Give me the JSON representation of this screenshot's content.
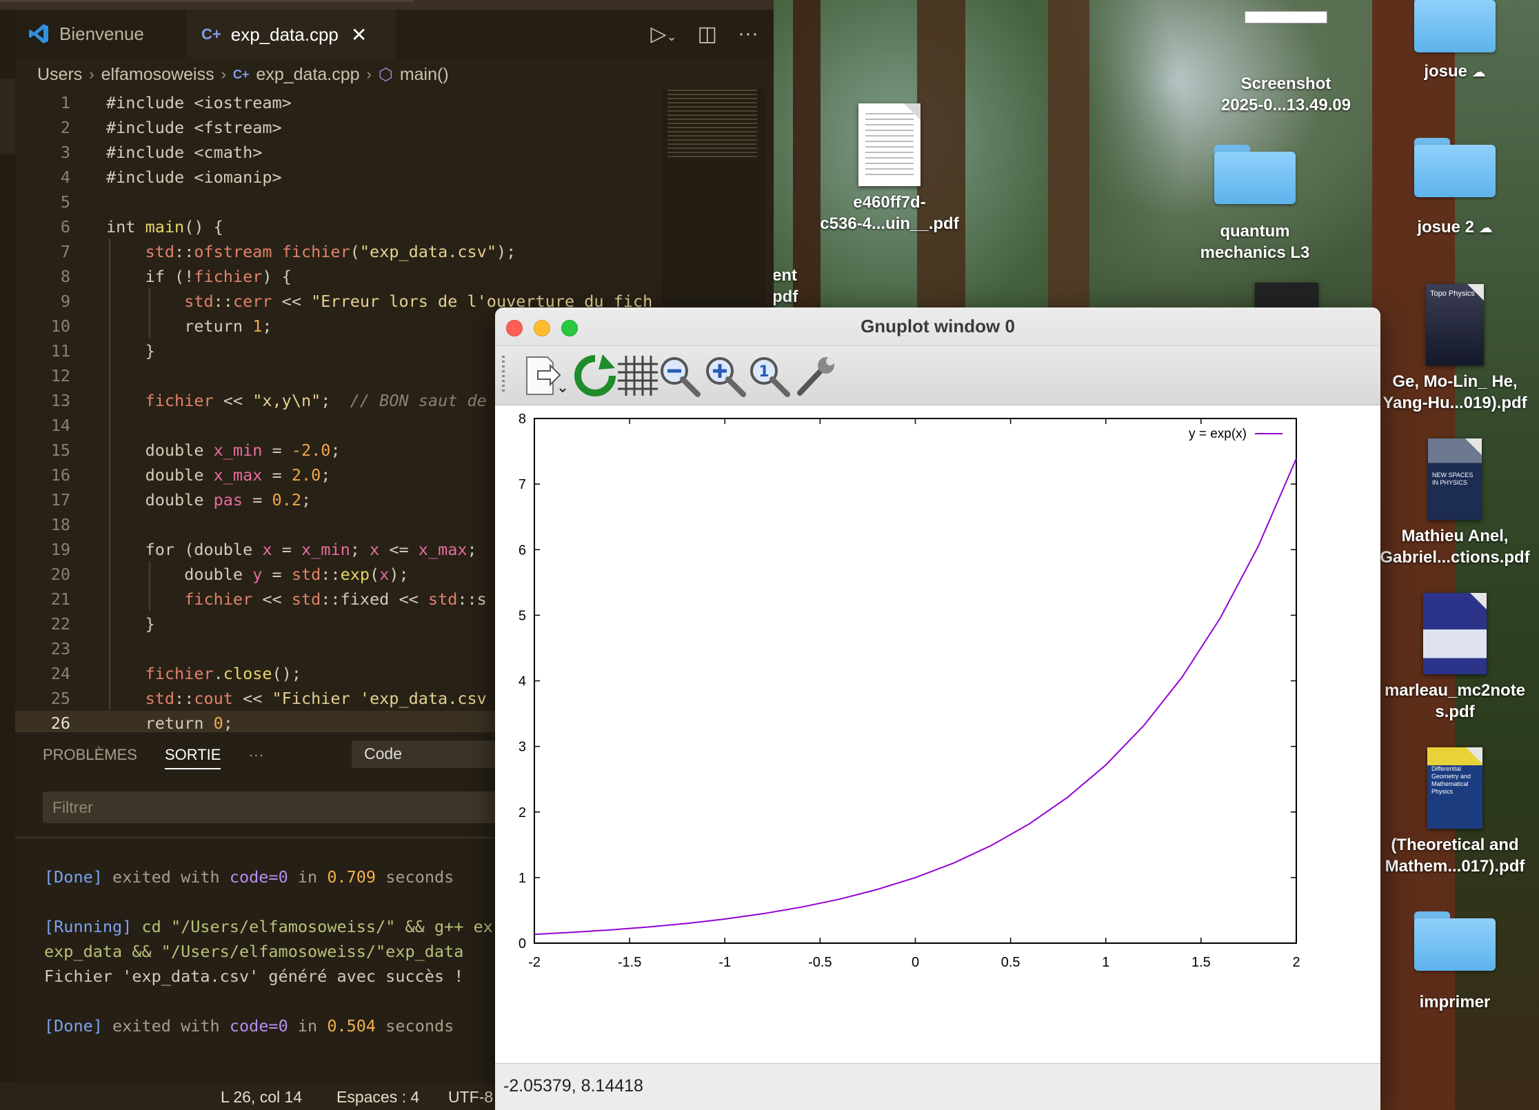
{
  "desktop": {
    "items": [
      {
        "label_lines": [
          "Screenshot",
          "2025-0...13.49.09"
        ],
        "kind": "screenshot"
      },
      {
        "label_lines": [
          "josue"
        ],
        "kind": "folder",
        "cloud": true
      },
      {
        "label_lines": [
          "e460ff7d-",
          "c536-4...uin__.pdf"
        ],
        "kind": "pdf"
      },
      {
        "label_lines": [
          "quantum",
          "mechanics L3"
        ],
        "kind": "folder"
      },
      {
        "label_lines": [
          "josue 2"
        ],
        "kind": "folder",
        "cloud": true
      },
      {
        "label_lines": [
          "ent",
          "pdf"
        ],
        "kind": "partial"
      },
      {
        "label_lines": [
          "Ge, Mo-Lin_ He,",
          "Yang-Hu...019).pdf"
        ],
        "kind": "book",
        "cover_title": "Topo Physics"
      },
      {
        "label_lines": [
          "Mathieu Anel,",
          "Gabriel...ctions.pdf"
        ],
        "kind": "book",
        "cover_title": "NEW SPACES IN PHYSICS"
      },
      {
        "label_lines": [
          "marleau_mc2note",
          "s.pdf"
        ],
        "kind": "book",
        "cover_title": ""
      },
      {
        "label_lines": [
          "(Theoretical and",
          "Mathem...017).pdf"
        ],
        "kind": "book",
        "cover_title": "Differential Geometry and Mathematical Physics"
      },
      {
        "label_lines": [
          "imprimer"
        ],
        "kind": "folder"
      }
    ]
  },
  "vscode": {
    "tabs": [
      {
        "label": "Bienvenue",
        "icon": "vscode-logo-icon",
        "active": false
      },
      {
        "label": "exp_data.cpp",
        "icon": "cpp-file-icon",
        "active": true
      }
    ],
    "breadcrumb": [
      "Users",
      "elfamosoweiss",
      "exp_data.cpp",
      "main()"
    ],
    "code_lines": [
      {
        "n": "1",
        "html": "<span class='k'>#include</span> <span class='k'>&lt;iostream&gt;</span>"
      },
      {
        "n": "2",
        "html": "<span class='k'>#include</span> <span class='k'>&lt;fstream&gt;</span>"
      },
      {
        "n": "3",
        "html": "<span class='k'>#include</span> <span class='k'>&lt;cmath&gt;</span>"
      },
      {
        "n": "4",
        "html": "<span class='k'>#include</span> <span class='k'>&lt;iomanip&gt;</span>"
      },
      {
        "n": "5",
        "html": ""
      },
      {
        "n": "6",
        "html": "<span class='k'>int</span> <span class='f'>main</span>() {"
      },
      {
        "n": "7",
        "html": "    <span class='t'>std</span>::<span class='t'>ofstream</span> <span class='t'>fichier</span>(<span class='s'>\"exp_data.csv\"</span>);"
      },
      {
        "n": "8",
        "html": "    <span class='k'>if</span> (!<span class='t'>fichier</span>) {"
      },
      {
        "n": "9",
        "html": "        <span class='t'>std</span>::<span class='t'>cerr</span> &lt;&lt; <span class='s'>\"Erreur lors de l'ouverture du fich</span>"
      },
      {
        "n": "10",
        "html": "        <span class='k'>return</span> <span class='n'>1</span>;"
      },
      {
        "n": "11",
        "html": "    }"
      },
      {
        "n": "12",
        "html": ""
      },
      {
        "n": "13",
        "html": "    <span class='t'>fichier</span> &lt;&lt; <span class='s'>\"x,y\\n\"</span>;  <span class='c'>// BON saut de</span>"
      },
      {
        "n": "14",
        "html": ""
      },
      {
        "n": "15",
        "html": "    <span class='k'>double</span> <span class='v'>x_min</span> = <span class='n'>-2.0</span>;"
      },
      {
        "n": "16",
        "html": "    <span class='k'>double</span> <span class='v'>x_max</span> = <span class='n'>2.0</span>;"
      },
      {
        "n": "17",
        "html": "    <span class='k'>double</span> <span class='v'>pas</span> = <span class='n'>0.2</span>;"
      },
      {
        "n": "18",
        "html": ""
      },
      {
        "n": "19",
        "html": "    <span class='k'>for</span> (<span class='k'>double</span> <span class='v'>x</span> = <span class='v'>x_min</span>; <span class='v'>x</span> &lt;= <span class='v'>x_max</span>;"
      },
      {
        "n": "20",
        "html": "        <span class='k'>double</span> <span class='v'>y</span> = <span class='t'>std</span>::<span class='f'>exp</span>(<span class='v'>x</span>);"
      },
      {
        "n": "21",
        "html": "        <span class='t'>fichier</span> &lt;&lt; <span class='t'>std</span>::<span class='k'>fixed</span> &lt;&lt; <span class='t'>std</span>::s"
      },
      {
        "n": "22",
        "html": "    }"
      },
      {
        "n": "23",
        "html": ""
      },
      {
        "n": "24",
        "html": "    <span class='t'>fichier</span>.<span class='f'>close</span>();"
      },
      {
        "n": "25",
        "html": "    <span class='t'>std</span>::<span class='t'>cout</span> &lt;&lt; <span class='s'>\"Fichier 'exp_data.csv</span>"
      },
      {
        "n": "26",
        "html": "    <span class='k'>return</span> <span class='n'>0</span>;"
      }
    ],
    "panel": {
      "tabs": [
        "PROBLÈMES",
        "SORTIE"
      ],
      "more": "···",
      "select_value": "Code",
      "filter_placeholder": "Filtrer",
      "output_lines": [
        "<span class='o-blue'>[Done]</span> <span class='o-grey'>exited with</span> <span class='o-code'>code=0</span> <span class='o-grey'>in</span> <span class='o-num'>0.709</span> <span class='o-grey'>seconds</span>",
        "",
        "<span class='o-blue'>[Running]</span> <span class='o-green'>cd \"/Users/elfamosoweiss/\" &amp;&amp; g++ ex</span>",
        "<span class='o-green'>exp_data &amp;&amp; \"/Users/elfamosoweiss/\"exp_data</span>",
        "Fichier 'exp_data.csv' généré avec succès !",
        "",
        "<span class='o-blue'>[Done]</span> <span class='o-grey'>exited with</span> <span class='o-code'>code=0</span> <span class='o-grey'>in</span> <span class='o-num'>0.504</span> <span class='o-grey'>seconds</span>"
      ]
    },
    "status": {
      "position": "L 26, col 14",
      "indent": "Espaces : 4",
      "encoding": "UTF-8"
    }
  },
  "gnuplot": {
    "title": "Gnuplot window 0",
    "toolbar": [
      "export-icon",
      "replot-icon",
      "grid-icon",
      "zoom-out-icon",
      "zoom-in-icon",
      "zoom-reset-icon",
      "settings-wrench-icon"
    ],
    "status_coords": "-2.05379,  8.14418",
    "colors": {
      "curve": "#9400d3",
      "axis": "#000000"
    }
  },
  "chart_data": {
    "type": "line",
    "title": "",
    "xlabel": "",
    "ylabel": "",
    "xlim": [
      -2,
      2
    ],
    "ylim": [
      0,
      8
    ],
    "xticks": [
      "-2",
      "-1.5",
      "-1",
      "-0.5",
      "0",
      "0.5",
      "1",
      "1.5",
      "2"
    ],
    "yticks": [
      "0",
      "1",
      "2",
      "3",
      "4",
      "5",
      "6",
      "7",
      "8"
    ],
    "grid": false,
    "legend": "top-right",
    "series": [
      {
        "name": "y = exp(x)",
        "color": "#9400d3",
        "x": [
          -2.0,
          -1.8,
          -1.6,
          -1.4,
          -1.2,
          -1.0,
          -0.8,
          -0.6,
          -0.4,
          -0.2,
          0.0,
          0.2,
          0.4,
          0.6,
          0.8,
          1.0,
          1.2,
          1.4,
          1.6,
          1.8,
          2.0
        ],
        "y": [
          0.135,
          0.165,
          0.202,
          0.247,
          0.301,
          0.368,
          0.449,
          0.549,
          0.67,
          0.819,
          1.0,
          1.221,
          1.492,
          1.822,
          2.226,
          2.718,
          3.32,
          4.055,
          4.953,
          6.05,
          7.389
        ]
      }
    ]
  }
}
